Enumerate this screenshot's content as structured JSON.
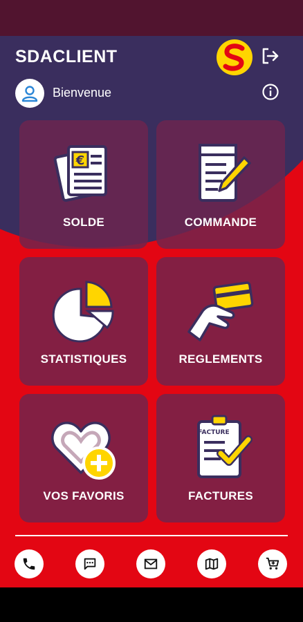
{
  "app": {
    "title": "SDACLIENT"
  },
  "user": {
    "welcome": "Bienvenue"
  },
  "colors": {
    "primary_red": "#e30613",
    "tile_bg": "#6e244e",
    "accent_yellow": "#ffd500",
    "dark_navy": "#3a2e5e"
  },
  "header": {
    "logo_icon": "sda-logo",
    "logout_icon": "logout-icon",
    "info_icon": "info-icon",
    "avatar_icon": "user-avatar-icon"
  },
  "tiles": [
    {
      "label": "SOLDE",
      "icon": "euro-document-icon"
    },
    {
      "label": "COMMANDE",
      "icon": "order-notepad-icon"
    },
    {
      "label": "STATISTIQUES",
      "icon": "pie-chart-icon"
    },
    {
      "label": "REGLEMENTS",
      "icon": "card-payment-icon"
    },
    {
      "label": "VOS FAVORIS",
      "icon": "favorite-heart-add-icon"
    },
    {
      "label": "FACTURES",
      "icon": "invoice-check-icon",
      "icon_text": "FACTURE"
    }
  ],
  "bottom_nav": [
    {
      "icon": "phone-icon"
    },
    {
      "icon": "chat-icon"
    },
    {
      "icon": "mail-icon"
    },
    {
      "icon": "map-icon"
    },
    {
      "icon": "cart-icon"
    }
  ]
}
